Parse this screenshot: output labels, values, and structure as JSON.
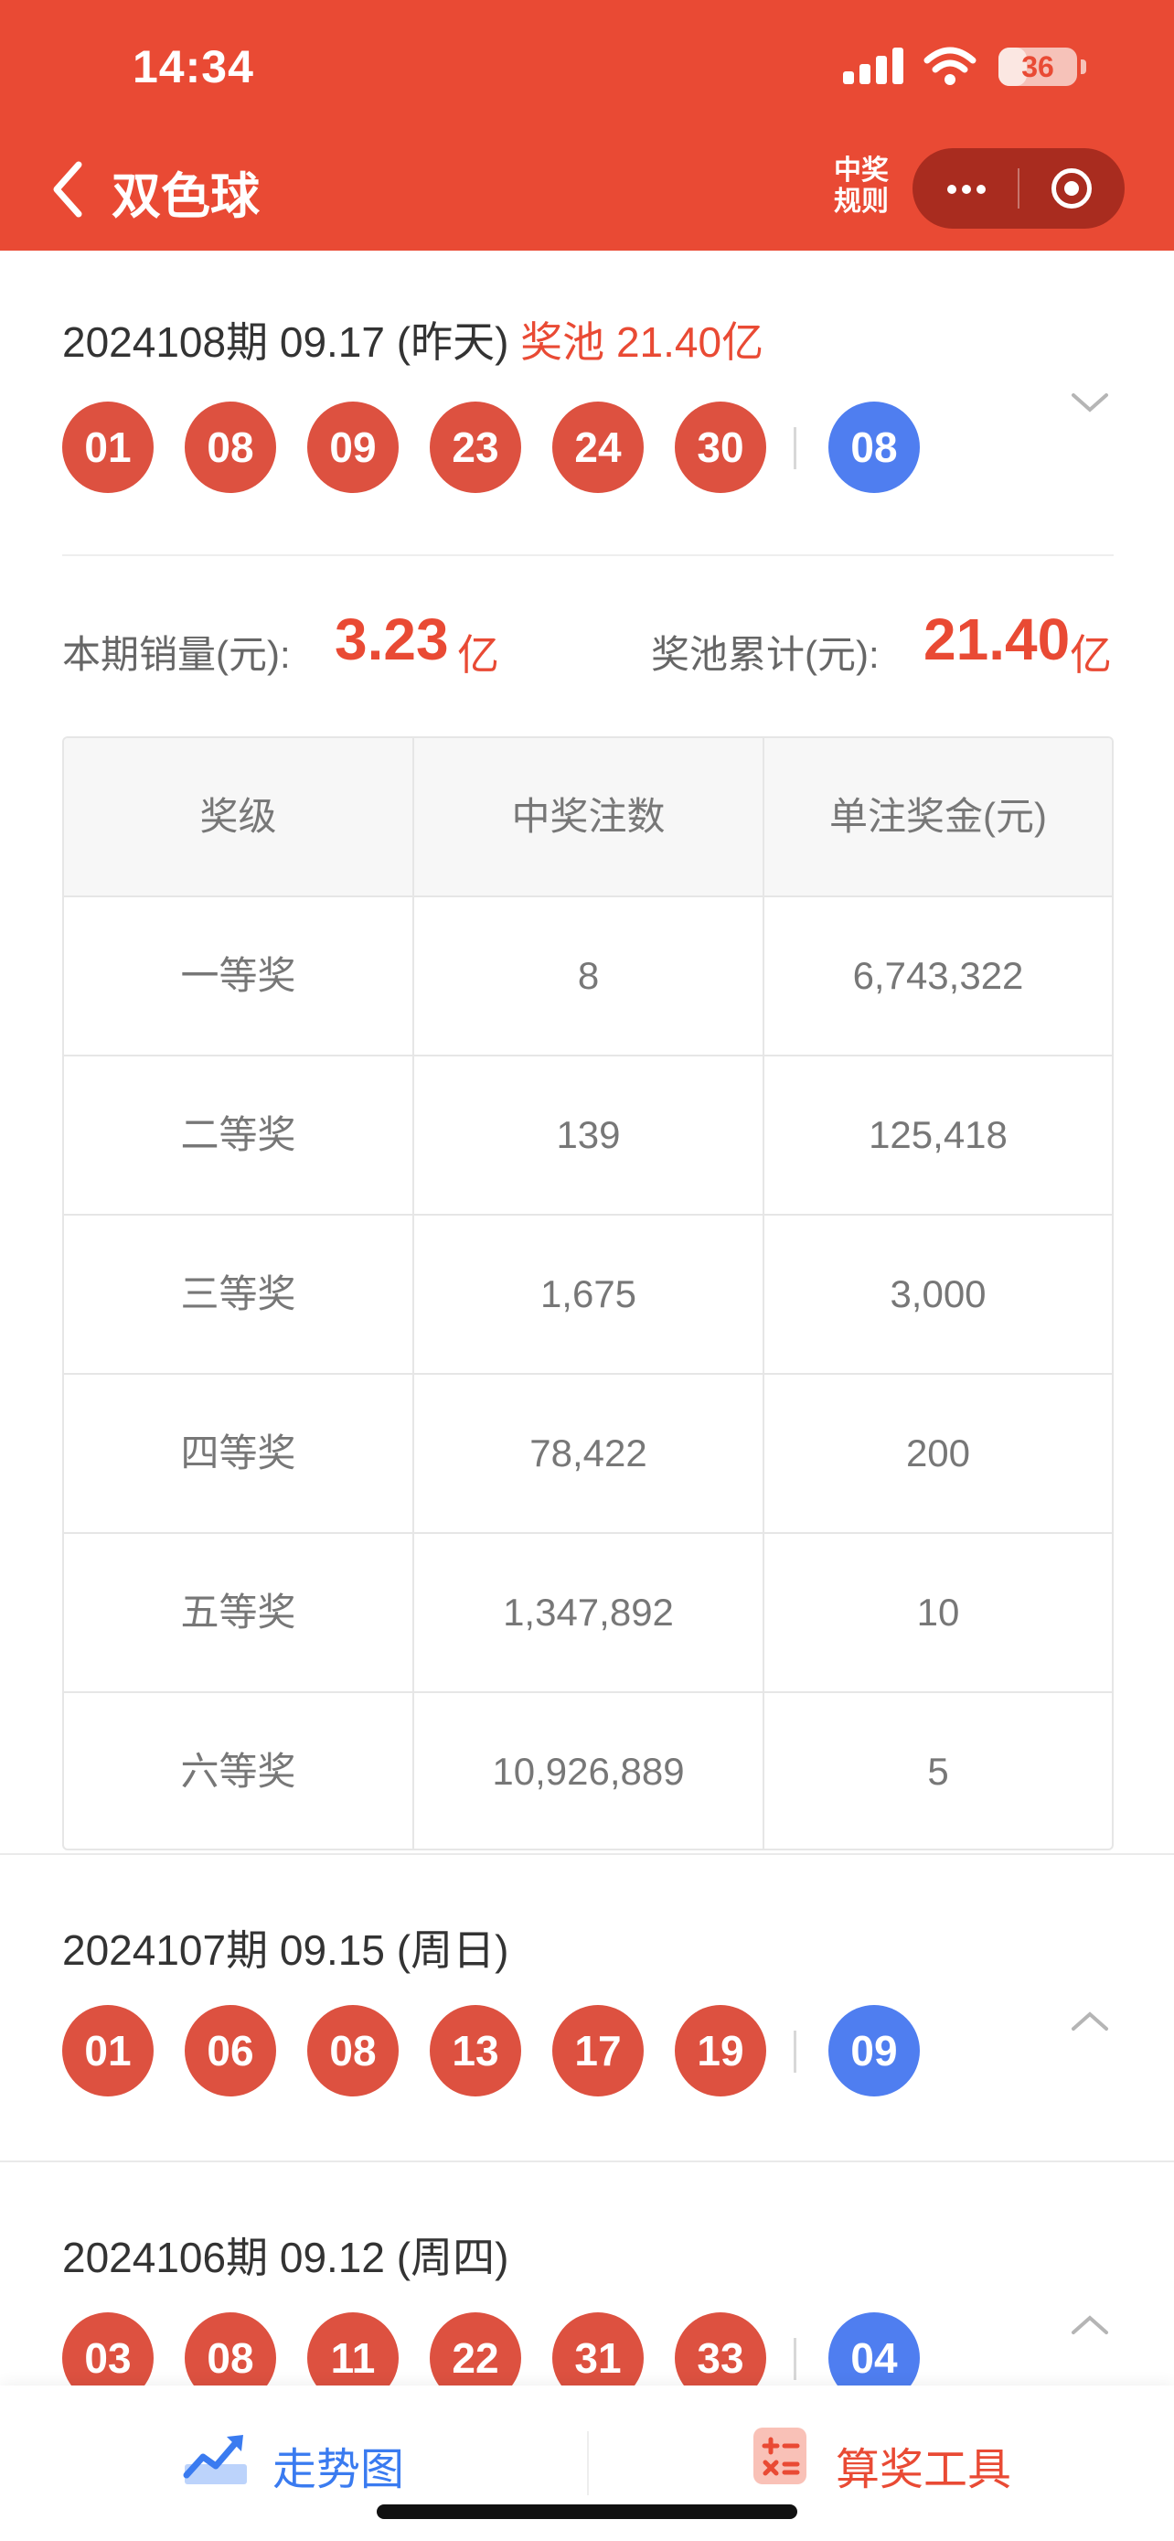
{
  "status_bar": {
    "time": "14:34",
    "battery": "36",
    "battery_level": 0.36
  },
  "nav": {
    "title": "双色球",
    "rules_label": "中奖\n规则"
  },
  "draws": [
    {
      "title": "2024108期 09.17 (昨天)",
      "pool_label": "奖池 21.40亿",
      "red_balls": [
        "01",
        "08",
        "09",
        "23",
        "24",
        "30"
      ],
      "blue_ball": "08"
    },
    {
      "title": "2024107期 09.15 (周日)",
      "red_balls": [
        "01",
        "06",
        "08",
        "13",
        "17",
        "19"
      ],
      "blue_ball": "09"
    },
    {
      "title": "2024106期 09.12 (周四)",
      "red_balls": [
        "03",
        "08",
        "11",
        "22",
        "31",
        "33"
      ],
      "blue_ball": "04"
    }
  ],
  "stats": {
    "sales_label": "本期销量(元):",
    "sales_value": "3.23",
    "sales_unit": "亿",
    "pool_label": "奖池累计(元):",
    "pool_value": "21.40",
    "pool_unit": "亿"
  },
  "prize_table": {
    "headers": [
      "奖级",
      "中奖注数",
      "单注奖金(元)"
    ],
    "rows": [
      [
        "一等奖",
        "8",
        "6,743,322"
      ],
      [
        "二等奖",
        "139",
        "125,418"
      ],
      [
        "三等奖",
        "1,675",
        "3,000"
      ],
      [
        "四等奖",
        "78,422",
        "200"
      ],
      [
        "五等奖",
        "1,347,892",
        "10"
      ],
      [
        "六等奖",
        "10,926,889",
        "5"
      ]
    ]
  },
  "bottom_tabs": {
    "trend_label": "走势图",
    "calc_label": "算奖工具"
  },
  "colors": {
    "brand_red": "#e94a34",
    "red_ball": "#dd5140",
    "blue_ball": "#4f7ef0",
    "trend_blue": "#3a7bf0",
    "calc_red": "#e94a34"
  }
}
